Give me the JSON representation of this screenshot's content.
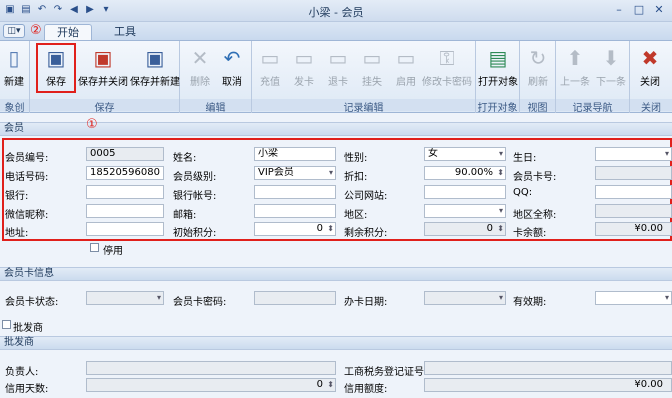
{
  "window": {
    "title": "小梁 - 会员"
  },
  "qat": {
    "save_icon": "floppy-icon",
    "undo_icon": "undo-icon",
    "redo_icon": "redo-icon"
  },
  "tabs": [
    {
      "label": "开始"
    },
    {
      "label": "工具"
    }
  ],
  "ribbon": {
    "new_label": "新建",
    "save_label": "保存",
    "save_close_label": "保存并关闭",
    "save_new_label": "保存并新建",
    "delete_label": "删除",
    "cancel_label": "取消",
    "topup_label": "充值",
    "issue_card_label": "发卡",
    "return_card_label": "退卡",
    "report_loss_label": "挂失",
    "enable_label": "启用",
    "change_pwd_label": "修改卡密码",
    "open_object_label": "打开对象",
    "refresh_label": "刷新",
    "prev_label": "上一条",
    "next_label": "下一条",
    "close_label": "关闭",
    "groups": [
      "象创建",
      "保存",
      "编辑",
      "记录编辑",
      "打开对象",
      "视图",
      "记录导航",
      "关闭"
    ]
  },
  "annotations": {
    "one": "①",
    "two": "②"
  },
  "member": {
    "section": "会员",
    "id_label": "会员编号:",
    "id_value": "0005",
    "name_label": "姓名:",
    "name_value": "小梁",
    "gender_label": "性别:",
    "gender_value": "女",
    "birthday_label": "生日:",
    "birthday_value": "",
    "phone_label": "电话号码:",
    "phone_value": "18520596080",
    "level_label": "会员级别:",
    "level_value": "VIP会员",
    "discount_label": "折扣:",
    "discount_value": "90.00%",
    "card_no_label": "会员卡号:",
    "card_no_value": "",
    "bank_label": "银行:",
    "bank_value": "",
    "bank_account_label": "银行帐号:",
    "bank_account_value": "",
    "website_label": "公司网站:",
    "website_value": "",
    "qq_label": "QQ:",
    "qq_value": "",
    "wechat_label": "微信昵称:",
    "wechat_value": "",
    "email_label": "邮箱:",
    "email_value": "",
    "region_label": "地区:",
    "region_value": "",
    "region_full_label": "地区全称:",
    "region_full_value": "",
    "address_label": "地址:",
    "address_value": "",
    "init_points_label": "初始积分:",
    "init_points_value": "0",
    "remain_points_label": "剩余积分:",
    "remain_points_value": "0",
    "balance_label": "卡余额:",
    "balance_value": "¥0.00",
    "disabled_label": "停用"
  },
  "card": {
    "section": "会员卡信息",
    "status_label": "会员卡状态:",
    "status_value": "",
    "password_label": "会员卡密码:",
    "password_value": "",
    "issue_date_label": "办卡日期:",
    "issue_date_value": "",
    "expiry_label": "有效期:",
    "expiry_value": ""
  },
  "wholesaler": {
    "checkbox_label": "批发商",
    "section": "批发商",
    "manager_label": "负责人:",
    "manager_value": "",
    "tax_label": "工商税务登记证号:",
    "tax_value": "",
    "credit_days_label": "信用天数:",
    "credit_days_value": "0",
    "credit_limit_label": "信用额度:",
    "credit_limit_value": "¥0.00"
  }
}
